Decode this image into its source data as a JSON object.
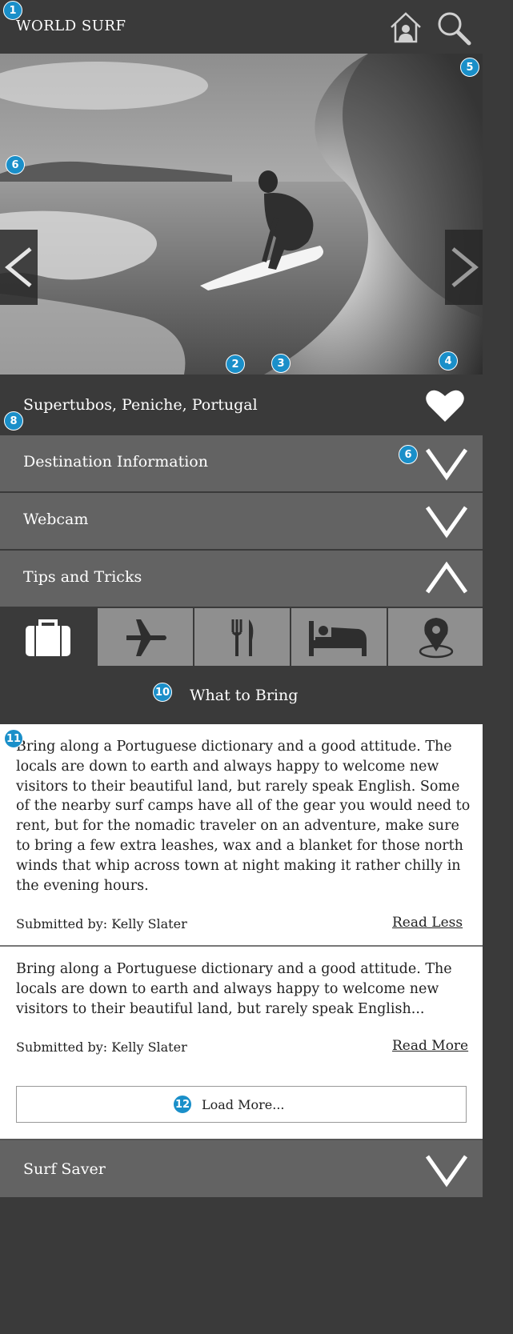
{
  "app": {
    "title": "WORLD SURF"
  },
  "colors": {
    "dark": "#3a3a3a",
    "section": "#636363",
    "tab_inactive": "#8f8f8f",
    "annotation": "#1a8fc9"
  },
  "icons": {
    "home": "home-user-icon",
    "search": "search-icon",
    "prev": "chevron-left-icon",
    "next": "chevron-right-icon",
    "favorite": "heart-icon",
    "collapse": "chevron-up-icon",
    "expand": "chevron-down-icon"
  },
  "annotations": [
    "1",
    "2",
    "3",
    "4",
    "5",
    "6",
    "6",
    "8",
    "10",
    "11",
    "12"
  ],
  "location": {
    "name": "Supertubos, Peniche, Portugal"
  },
  "sections": [
    {
      "label": "Destination Information",
      "state": "collapsed"
    },
    {
      "label": "Webcam",
      "state": "collapsed"
    },
    {
      "label": "Tips and Tricks",
      "state": "expanded"
    }
  ],
  "tabs": [
    {
      "icon": "suitcase-icon",
      "active": true
    },
    {
      "icon": "airplane-icon",
      "active": false
    },
    {
      "icon": "fork-knife-icon",
      "active": false
    },
    {
      "icon": "bed-icon",
      "active": false
    },
    {
      "icon": "map-pin-icon",
      "active": false
    }
  ],
  "tab_title": "What to Bring",
  "tips": [
    {
      "text": "Bring along a Portuguese dictionary and a good attitude. The locals are down to earth and always happy to welcome new visitors to their beautiful land, but rarely speak English. Some of the nearby surf camps have all of the gear you would need to rent, but for the nomadic traveler on an adventure, make sure to bring a few extra leashes, wax and a blanket for those north winds that whip across town at night making it rather chilly in the evening hours.",
      "submitted": "Submitted by:  Kelly Slater",
      "link": "Read Less"
    },
    {
      "text": "Bring along a Portuguese dictionary and a good attitude. The locals are down to earth and always happy to welcome new visitors to their beautiful land, but rarely speak English...",
      "submitted": "Submitted by:  Kelly Slater",
      "link": "Read More"
    }
  ],
  "load_more": "Load More...",
  "bottom_section": {
    "label": "Surf Saver"
  }
}
